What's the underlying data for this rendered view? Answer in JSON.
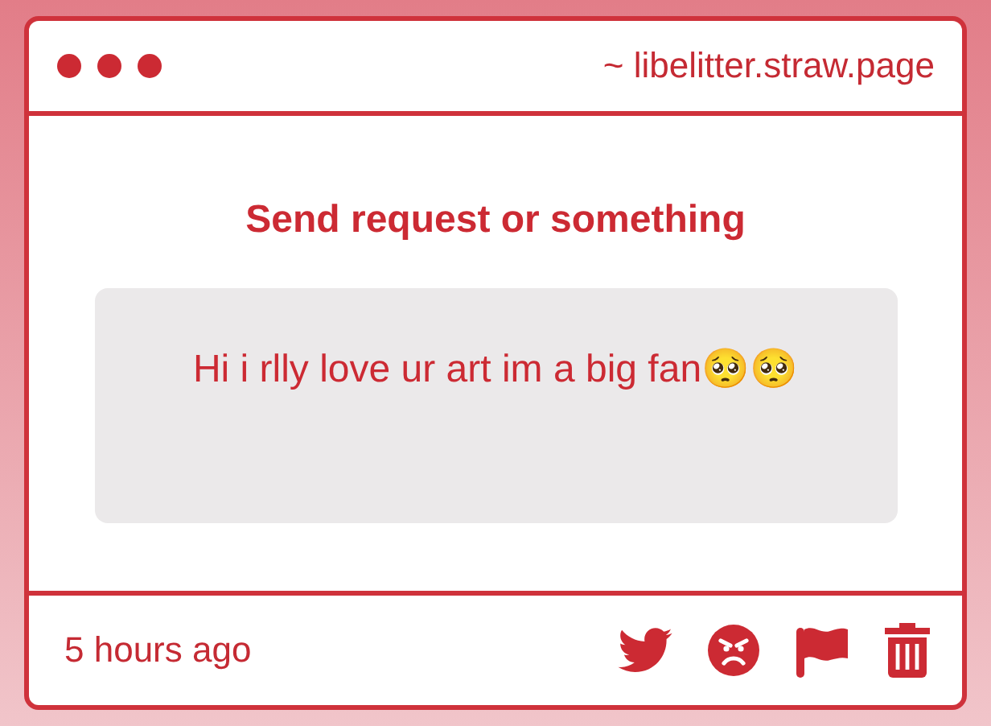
{
  "window": {
    "address": "~ libelitter.straw.page"
  },
  "title": "Send request or something",
  "message": "Hi i rlly love ur art im a big fan🥺🥺",
  "footer": {
    "time": "5 hours ago"
  }
}
